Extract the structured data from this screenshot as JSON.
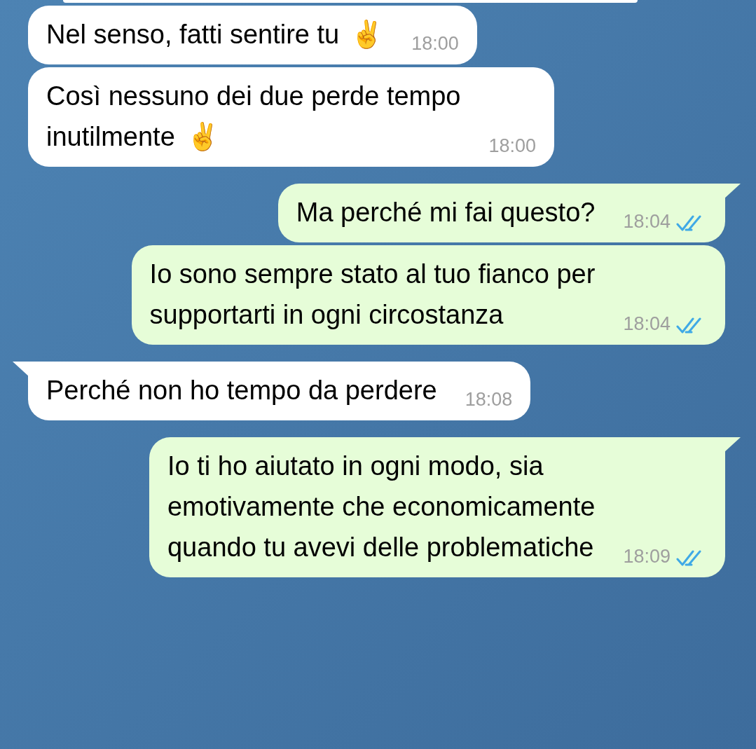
{
  "messages": [
    {
      "kind": "cut"
    },
    {
      "kind": "incoming",
      "text": "Nel senso, fatti sentire tu",
      "emoji": "✌️",
      "time": "18:00",
      "tail": false
    },
    {
      "kind": "incoming",
      "text": "Così nessuno dei due perde tempo\ninutilmente",
      "emoji": "✌️",
      "time": "18:00",
      "tail": false
    },
    {
      "kind": "outgoing",
      "text": "Ma perché mi fai questo?",
      "time": "18:04",
      "tail": true,
      "read": true
    },
    {
      "kind": "outgoing",
      "text": "Io sono sempre stato al tuo fianco per\nsupportarti in ogni circostanza",
      "time": "18:04",
      "tail": false,
      "read": true
    },
    {
      "kind": "incoming",
      "text": "Perché non ho tempo da perdere",
      "time": "18:08",
      "tail": true
    },
    {
      "kind": "outgoing",
      "text": "Io ti ho aiutato in ogni modo, sia\nemotivamente che economicamente\nquando tu avevi delle problematiche",
      "time": "18:09",
      "tail": true,
      "read": true
    }
  ]
}
